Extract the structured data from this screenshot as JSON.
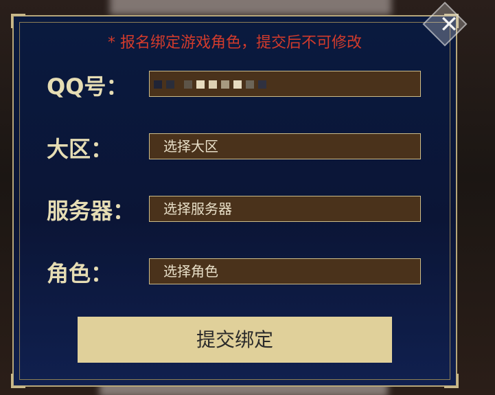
{
  "notice": "* 报名绑定游戏角色，提交后不可修改",
  "form": {
    "qq_label": "QQ号：",
    "qq_value_masked": true,
    "region_label": "大区：",
    "region_placeholder": "选择大区",
    "server_label": "服务器：",
    "server_placeholder": "选择服务器",
    "role_label": "角色：",
    "role_placeholder": "选择角色"
  },
  "submit_label": "提交绑定",
  "colors": {
    "accent_red": "#d23b2c",
    "label_gold": "#e6ddb4",
    "field_brown": "#4a321b",
    "button_gold": "#e0d09a",
    "modal_navy": "#0a1a3f"
  },
  "icons": {
    "close": "close-icon"
  }
}
